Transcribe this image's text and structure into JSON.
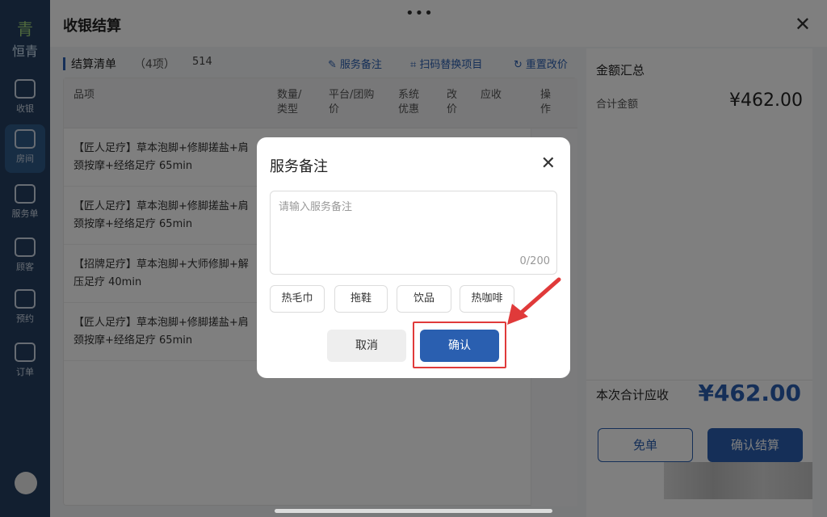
{
  "sidebar": {
    "logo": "青",
    "brand": "恒青",
    "items": [
      {
        "label": "收银"
      },
      {
        "label": "房间"
      },
      {
        "label": "服务单"
      },
      {
        "label": "顾客"
      },
      {
        "label": "预约"
      },
      {
        "label": "订单"
      }
    ]
  },
  "header": {
    "handle": "•••",
    "title": "收银结算",
    "close": "✕"
  },
  "list": {
    "title": "结算清单",
    "count": "（4项）",
    "number": "514",
    "links": [
      {
        "icon": "✎",
        "label": "服务备注"
      },
      {
        "icon": "⌗",
        "label": "扫码替换项目"
      },
      {
        "icon": "↻",
        "label": "重置改价"
      }
    ]
  },
  "table": {
    "columns": [
      {
        "l1": "品项",
        "l2": ""
      },
      {
        "l1": "数量/",
        "l2": "类型"
      },
      {
        "l1": "平台/团购",
        "l2": "价"
      },
      {
        "l1": "系统",
        "l2": "优惠"
      },
      {
        "l1": "改",
        "l2": "价"
      },
      {
        "l1": "应收",
        "l2": ""
      },
      {
        "l1": "操",
        "l2": "作"
      }
    ],
    "rows": [
      {
        "l1": "【匠人足疗】草本泡脚+修脚搓盐+肩",
        "l2": "颈按摩+经络足疗 65min"
      },
      {
        "l1": "【匠人足疗】草本泡脚+修脚搓盐+肩",
        "l2": "颈按摩+经络足疗 65min"
      },
      {
        "l1": "【招牌足疗】草本泡脚+大师修脚+解",
        "l2": "压足疗 40min"
      },
      {
        "l1": "【匠人足疗】草本泡脚+修脚搓盐+肩",
        "l2": "颈按摩+经络足疗 65min"
      }
    ]
  },
  "summary": {
    "title": "金额汇总",
    "total_label": "合计金额",
    "total_amount": "¥462.00",
    "due_label": "本次合计应收",
    "due_amount": "¥462.00",
    "free_label": "免单",
    "confirm_label": "确认结算"
  },
  "modal": {
    "title": "服务备注",
    "close": "✕",
    "placeholder": "请输入服务备注",
    "counter": "0/200",
    "chips": [
      "热毛巾",
      "拖鞋",
      "饮品",
      "热咖啡"
    ],
    "cancel_label": "取消",
    "ok_label": "确认"
  },
  "colors": {
    "accent": "#2a5fb0",
    "highlight": "#e03a3a"
  }
}
